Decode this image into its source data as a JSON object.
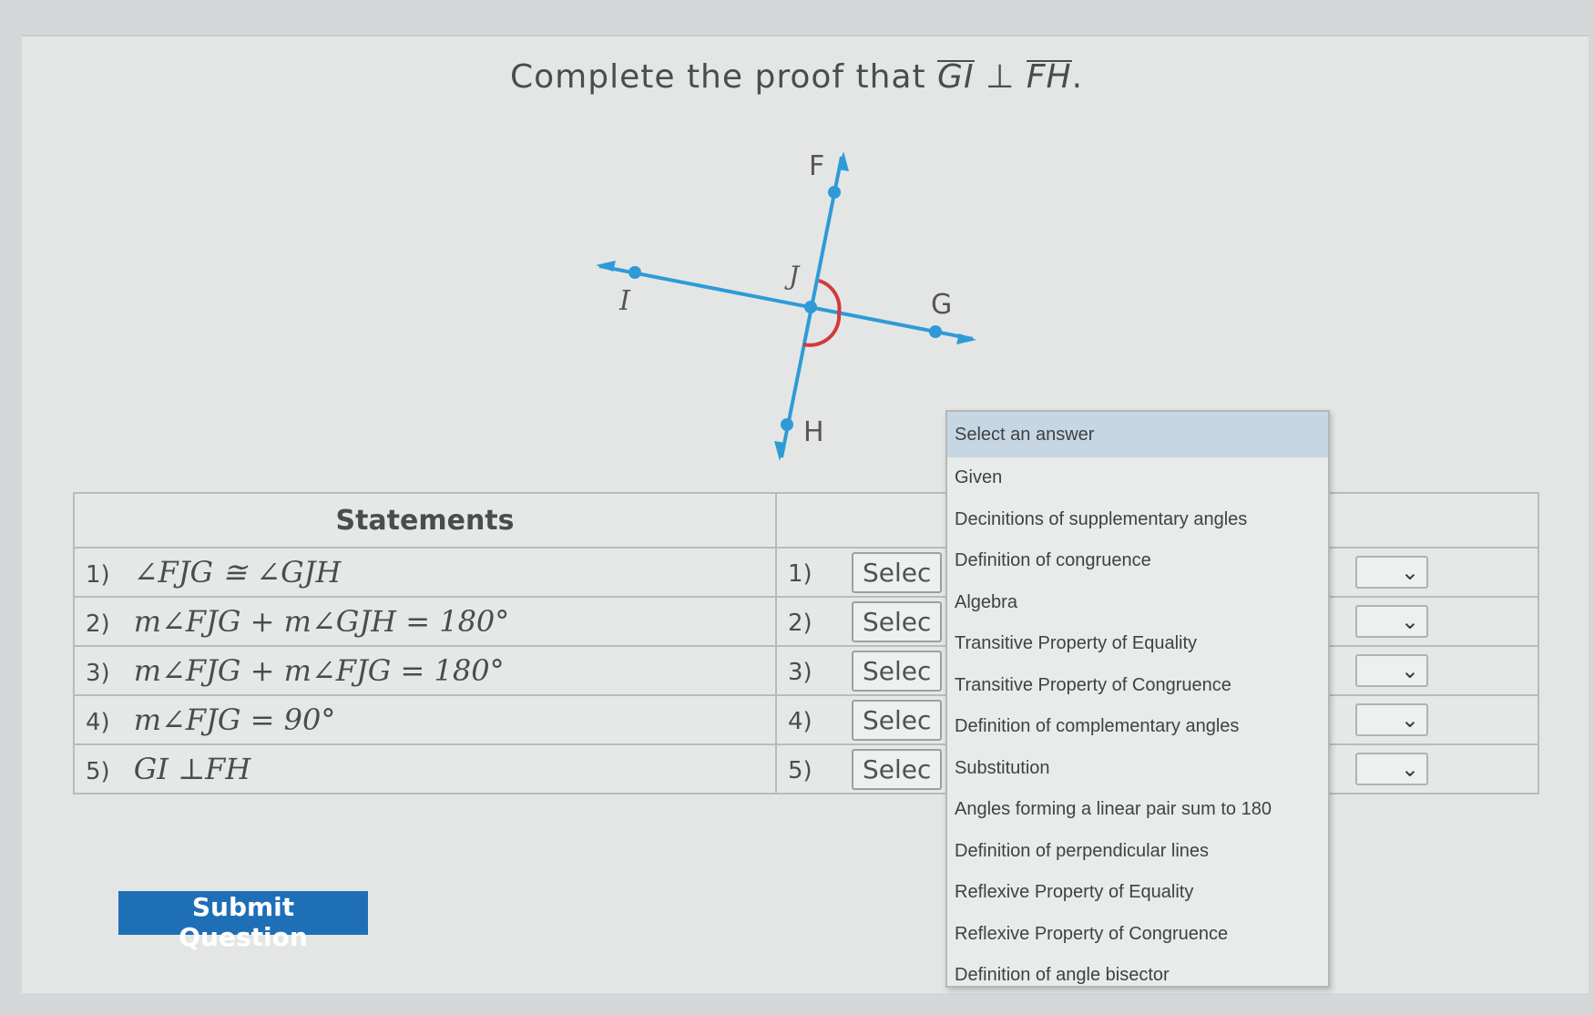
{
  "title": {
    "prefix": "Complete the proof that ",
    "ray1": "GI",
    "perp": "⊥",
    "ray2": "FH",
    "suffix": "."
  },
  "diagram": {
    "labels": {
      "F": "F",
      "J": "J",
      "I": "I",
      "G": "G",
      "H": "H"
    },
    "line_color": "#2e9bd6",
    "arc_color": "#d23b3b"
  },
  "table": {
    "headers": {
      "statements": "Statements",
      "reasons": ""
    },
    "rows": [
      {
        "num": "1)",
        "statement": "∠FJG ≅ ∠GJH",
        "reason_num": "1)",
        "reason_value": "Selec"
      },
      {
        "num": "2)",
        "statement": "m∠FJG + m∠GJH = 180°",
        "reason_num": "2)",
        "reason_value": "Selec"
      },
      {
        "num": "3)",
        "statement": "m∠FJG + m∠FJG = 180°",
        "reason_num": "3)",
        "reason_value": "Selec"
      },
      {
        "num": "4)",
        "statement": "m∠FJG = 90°",
        "reason_num": "4)",
        "reason_value": "Selec"
      },
      {
        "num": "5)",
        "statement": "GI ⊥FH",
        "reason_num": "5)",
        "reason_value": "Selec"
      }
    ]
  },
  "dropdown": {
    "options": [
      "Select an answer",
      "Given",
      "Decinitions of supplementary angles",
      "Definition of congruence",
      "Algebra",
      "Transitive Property of Equality",
      "Transitive Property of Congruence",
      "Definition of complementary angles",
      "Substitution",
      "Angles forming a linear pair sum to 180",
      "Definition of perpendicular lines",
      "Reflexive Property of Equality",
      "Reflexive Property of Congruence",
      "Definition of angle bisector"
    ],
    "selected_index": 0,
    "chevron_icon": "⌄"
  },
  "submit": {
    "label": "Submit Question"
  },
  "colors": {
    "accent": "#1f6fb7",
    "highlight": "#c6d7e3"
  }
}
